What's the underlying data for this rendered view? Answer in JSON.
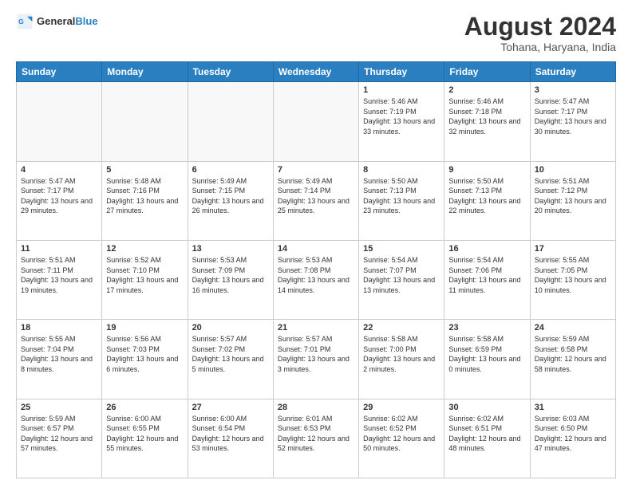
{
  "header": {
    "logo_general": "General",
    "logo_blue": "Blue",
    "month_title": "August 2024",
    "location": "Tohana, Haryana, India"
  },
  "weekdays": [
    "Sunday",
    "Monday",
    "Tuesday",
    "Wednesday",
    "Thursday",
    "Friday",
    "Saturday"
  ],
  "weeks": [
    [
      {
        "day": "",
        "empty": true
      },
      {
        "day": "",
        "empty": true
      },
      {
        "day": "",
        "empty": true
      },
      {
        "day": "",
        "empty": true
      },
      {
        "day": "1",
        "sunrise": "5:46 AM",
        "sunset": "7:19 PM",
        "daylight": "13 hours and 33 minutes."
      },
      {
        "day": "2",
        "sunrise": "5:46 AM",
        "sunset": "7:18 PM",
        "daylight": "13 hours and 32 minutes."
      },
      {
        "day": "3",
        "sunrise": "5:47 AM",
        "sunset": "7:17 PM",
        "daylight": "13 hours and 30 minutes."
      }
    ],
    [
      {
        "day": "4",
        "sunrise": "5:47 AM",
        "sunset": "7:17 PM",
        "daylight": "13 hours and 29 minutes."
      },
      {
        "day": "5",
        "sunrise": "5:48 AM",
        "sunset": "7:16 PM",
        "daylight": "13 hours and 27 minutes."
      },
      {
        "day": "6",
        "sunrise": "5:49 AM",
        "sunset": "7:15 PM",
        "daylight": "13 hours and 26 minutes."
      },
      {
        "day": "7",
        "sunrise": "5:49 AM",
        "sunset": "7:14 PM",
        "daylight": "13 hours and 25 minutes."
      },
      {
        "day": "8",
        "sunrise": "5:50 AM",
        "sunset": "7:13 PM",
        "daylight": "13 hours and 23 minutes."
      },
      {
        "day": "9",
        "sunrise": "5:50 AM",
        "sunset": "7:13 PM",
        "daylight": "13 hours and 22 minutes."
      },
      {
        "day": "10",
        "sunrise": "5:51 AM",
        "sunset": "7:12 PM",
        "daylight": "13 hours and 20 minutes."
      }
    ],
    [
      {
        "day": "11",
        "sunrise": "5:51 AM",
        "sunset": "7:11 PM",
        "daylight": "13 hours and 19 minutes."
      },
      {
        "day": "12",
        "sunrise": "5:52 AM",
        "sunset": "7:10 PM",
        "daylight": "13 hours and 17 minutes."
      },
      {
        "day": "13",
        "sunrise": "5:53 AM",
        "sunset": "7:09 PM",
        "daylight": "13 hours and 16 minutes."
      },
      {
        "day": "14",
        "sunrise": "5:53 AM",
        "sunset": "7:08 PM",
        "daylight": "13 hours and 14 minutes."
      },
      {
        "day": "15",
        "sunrise": "5:54 AM",
        "sunset": "7:07 PM",
        "daylight": "13 hours and 13 minutes."
      },
      {
        "day": "16",
        "sunrise": "5:54 AM",
        "sunset": "7:06 PM",
        "daylight": "13 hours and 11 minutes."
      },
      {
        "day": "17",
        "sunrise": "5:55 AM",
        "sunset": "7:05 PM",
        "daylight": "13 hours and 10 minutes."
      }
    ],
    [
      {
        "day": "18",
        "sunrise": "5:55 AM",
        "sunset": "7:04 PM",
        "daylight": "13 hours and 8 minutes."
      },
      {
        "day": "19",
        "sunrise": "5:56 AM",
        "sunset": "7:03 PM",
        "daylight": "13 hours and 6 minutes."
      },
      {
        "day": "20",
        "sunrise": "5:57 AM",
        "sunset": "7:02 PM",
        "daylight": "13 hours and 5 minutes."
      },
      {
        "day": "21",
        "sunrise": "5:57 AM",
        "sunset": "7:01 PM",
        "daylight": "13 hours and 3 minutes."
      },
      {
        "day": "22",
        "sunrise": "5:58 AM",
        "sunset": "7:00 PM",
        "daylight": "13 hours and 2 minutes."
      },
      {
        "day": "23",
        "sunrise": "5:58 AM",
        "sunset": "6:59 PM",
        "daylight": "13 hours and 0 minutes."
      },
      {
        "day": "24",
        "sunrise": "5:59 AM",
        "sunset": "6:58 PM",
        "daylight": "12 hours and 58 minutes."
      }
    ],
    [
      {
        "day": "25",
        "sunrise": "5:59 AM",
        "sunset": "6:57 PM",
        "daylight": "12 hours and 57 minutes."
      },
      {
        "day": "26",
        "sunrise": "6:00 AM",
        "sunset": "6:55 PM",
        "daylight": "12 hours and 55 minutes."
      },
      {
        "day": "27",
        "sunrise": "6:00 AM",
        "sunset": "6:54 PM",
        "daylight": "12 hours and 53 minutes."
      },
      {
        "day": "28",
        "sunrise": "6:01 AM",
        "sunset": "6:53 PM",
        "daylight": "12 hours and 52 minutes."
      },
      {
        "day": "29",
        "sunrise": "6:02 AM",
        "sunset": "6:52 PM",
        "daylight": "12 hours and 50 minutes."
      },
      {
        "day": "30",
        "sunrise": "6:02 AM",
        "sunset": "6:51 PM",
        "daylight": "12 hours and 48 minutes."
      },
      {
        "day": "31",
        "sunrise": "6:03 AM",
        "sunset": "6:50 PM",
        "daylight": "12 hours and 47 minutes."
      }
    ]
  ]
}
